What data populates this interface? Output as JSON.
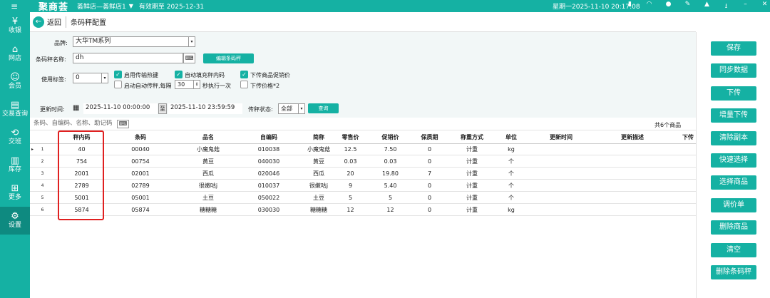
{
  "topbar": {
    "brand": "聚商荟",
    "store": "荟鲜店—荟鲜店1",
    "expiry": "有效期至 2025-12-31",
    "datetime": "星期一2025-11-10 20:17:08"
  },
  "sidebar": {
    "items": [
      {
        "label": "收银",
        "icon": "register-icon"
      },
      {
        "label": "网店",
        "icon": "shop-icon"
      },
      {
        "label": "会员",
        "icon": "member-icon"
      },
      {
        "label": "交易查询",
        "icon": "document-icon"
      },
      {
        "label": "交班",
        "icon": "handover-icon"
      },
      {
        "label": "库存",
        "icon": "warehouse-icon"
      },
      {
        "label": "更多",
        "icon": "more-icon"
      },
      {
        "label": "设置",
        "icon": "settings-icon"
      }
    ]
  },
  "header": {
    "back_label": "返回",
    "title": "条码秤配置"
  },
  "form": {
    "brand_label": "品牌:",
    "brand_value": "大华TM系列",
    "scale_name_label": "条码秤名称:",
    "scale_name_value": "dh",
    "edit_scale_btn": "编辑条码秤",
    "tag_label": "使用标签:",
    "tag_value": "0",
    "chk_hotkey": "启用传输热键",
    "chk_autofill": "自动填充秤内码",
    "chk_promo": "下传商品促销价",
    "chk_auto_transfer": "启动自动传秤,每隔",
    "interval_value": "30",
    "interval_unit": "秒执行一次",
    "chk_price2": "下传价格*2"
  },
  "filter": {
    "update_time_label": "更新时间:",
    "start_time": "2025-11-10 00:00:00",
    "to_label": "至",
    "end_time": "2025-11-10 23:59:59",
    "status_label": "传秤状态:",
    "status_value": "全部",
    "query_btn": "查询"
  },
  "search": {
    "placeholder": "条码、自编码、名称、助记码",
    "count": "共6个商品"
  },
  "table": {
    "headers": [
      "秤内码",
      "条码",
      "品名",
      "自编码",
      "简称",
      "零售价",
      "促销价",
      "保质期",
      "称重方式",
      "单位",
      "更新时间",
      "更新描述",
      "下传"
    ],
    "rows": [
      {
        "idx": "1",
        "code": "40",
        "barcode": "00040",
        "name": "小魔鬼菇",
        "selfcode": "010038",
        "short": "小魔鬼菇",
        "retail": "12.5",
        "promo": "7.50",
        "shelf": "0",
        "weigh": "计重",
        "unit": "kg"
      },
      {
        "idx": "2",
        "code": "754",
        "barcode": "00754",
        "name": "黄豆",
        "selfcode": "040030",
        "short": "黄豆",
        "retail": "0.03",
        "promo": "0.03",
        "shelf": "0",
        "weigh": "计重",
        "unit": "个"
      },
      {
        "idx": "3",
        "code": "2001",
        "barcode": "02001",
        "name": "西瓜",
        "selfcode": "020046",
        "short": "西瓜",
        "retail": "20",
        "promo": "19.80",
        "shelf": "7",
        "weigh": "计重",
        "unit": "个"
      },
      {
        "idx": "4",
        "code": "2789",
        "barcode": "02789",
        "name": "很嫩咕j",
        "selfcode": "010037",
        "short": "很嫩咕j",
        "retail": "9",
        "promo": "5.40",
        "shelf": "0",
        "weigh": "计重",
        "unit": "个"
      },
      {
        "idx": "5",
        "code": "5001",
        "barcode": "05001",
        "name": "土豆",
        "selfcode": "050022",
        "short": "土豆",
        "retail": "5",
        "promo": "5",
        "shelf": "0",
        "weigh": "计重",
        "unit": "个"
      },
      {
        "idx": "6",
        "code": "5874",
        "barcode": "05874",
        "name": "糖糖糖",
        "selfcode": "030030",
        "short": "糖糖糖",
        "retail": "12",
        "promo": "12",
        "shelf": "0",
        "weigh": "计重",
        "unit": "kg"
      }
    ]
  },
  "actions": [
    "保存",
    "同步数据",
    "下传",
    "增量下传",
    "清除副本",
    "快速选择",
    "选择商品",
    "调价单",
    "删除商品",
    "清空",
    "删除条码秤"
  ],
  "colors": {
    "accent": "#15b1a3",
    "highlight": "#e02020"
  }
}
